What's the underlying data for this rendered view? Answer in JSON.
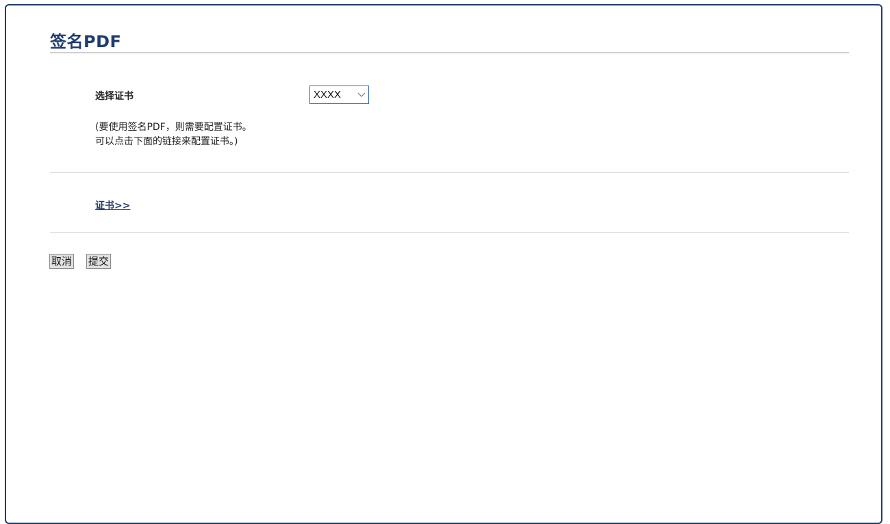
{
  "page": {
    "title": "签名PDF"
  },
  "form": {
    "certificate_label": "选择证书",
    "certificate_select": {
      "selected": "XXXX"
    },
    "note_line1": "(要使用签名PDF，则需要配置证书。",
    "note_line2": "可以点击下面的链接来配置证书。)",
    "certificate_link": "证书>>"
  },
  "actions": {
    "cancel_label": "取消",
    "submit_label": "提交"
  },
  "colors": {
    "title": "#1f3c6e",
    "border": "#1f3c6e",
    "link": "#1f3c6e",
    "select_border": "#3c6fb8"
  },
  "icons": {
    "select_arrow": "chevron-down-icon"
  }
}
